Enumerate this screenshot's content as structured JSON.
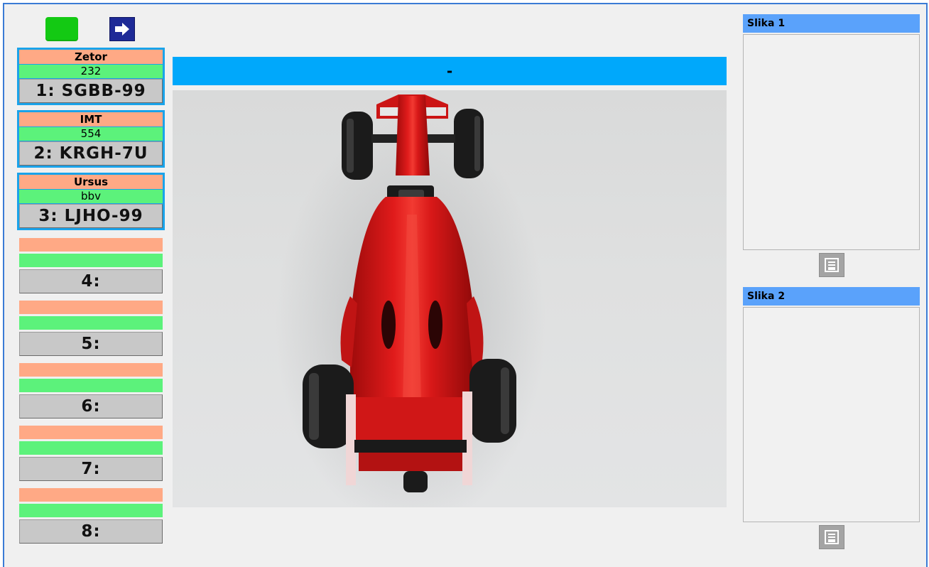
{
  "toolbar": {
    "status_color": "#13c913",
    "status_icon": "green-status-indicator",
    "next_icon": "right-arrow-icon"
  },
  "slots": [
    {
      "brand": "Zetor",
      "value": "232",
      "plate": "1: SGBB-99",
      "active": true
    },
    {
      "brand": "IMT",
      "value": "554",
      "plate": "2: KRGH-7U",
      "active": true
    },
    {
      "brand": "Ursus",
      "value": "bbv",
      "plate": "3: LJHO-99",
      "active": true
    },
    {
      "brand": "",
      "value": "",
      "plate": "4:",
      "active": false
    },
    {
      "brand": "",
      "value": "",
      "plate": "5:",
      "active": false
    },
    {
      "brand": "",
      "value": "",
      "plate": "6:",
      "active": false
    },
    {
      "brand": "",
      "value": "",
      "plate": "7:",
      "active": false
    },
    {
      "brand": "",
      "value": "",
      "plate": "8:",
      "active": false
    }
  ],
  "center": {
    "title": "-",
    "image_subject": "red formula-one toy car, top view"
  },
  "panels": [
    {
      "title": "Slika 1",
      "save_icon": "save-icon"
    },
    {
      "title": "Slika 2",
      "save_icon": "save-icon"
    }
  ],
  "colors": {
    "accent_blue": "#00a8fb",
    "panel_blue": "#5aa2fb",
    "brand_orange": "#ffa985",
    "value_green": "#5cf27b",
    "plate_gray": "#c8c8c8",
    "active_border": "#1aa3ea"
  }
}
